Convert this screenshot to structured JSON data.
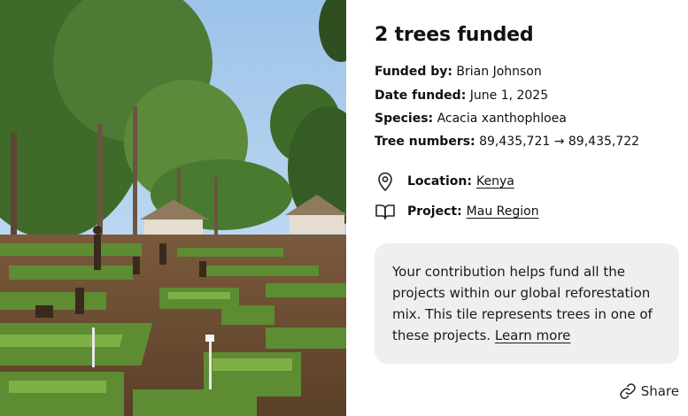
{
  "photo": {
    "icon": "tree-nursery-photo"
  },
  "card": {
    "title": "2 trees funded",
    "funded_by_label": "Funded by:",
    "funded_by": "Brian Johnson",
    "date_label": "Date funded:",
    "date": "June 1, 2025",
    "species_label": "Species:",
    "species": "Acacia xanthophloea",
    "tree_numbers_label": "Tree numbers:",
    "tree_numbers": "89,435,721 → 89,435,722",
    "location_label": "Location:",
    "location": "Kenya",
    "location_icon": "map-pin-icon",
    "project_label": "Project:",
    "project": "Mau Region",
    "project_icon": "open-book-icon"
  },
  "callout": {
    "text": "Your contribution helps fund all the projects within our global reforestation mix. This tile represents trees in one of these projects.",
    "link": "Learn more"
  },
  "share": {
    "label": "Share",
    "icon": "link-icon"
  }
}
